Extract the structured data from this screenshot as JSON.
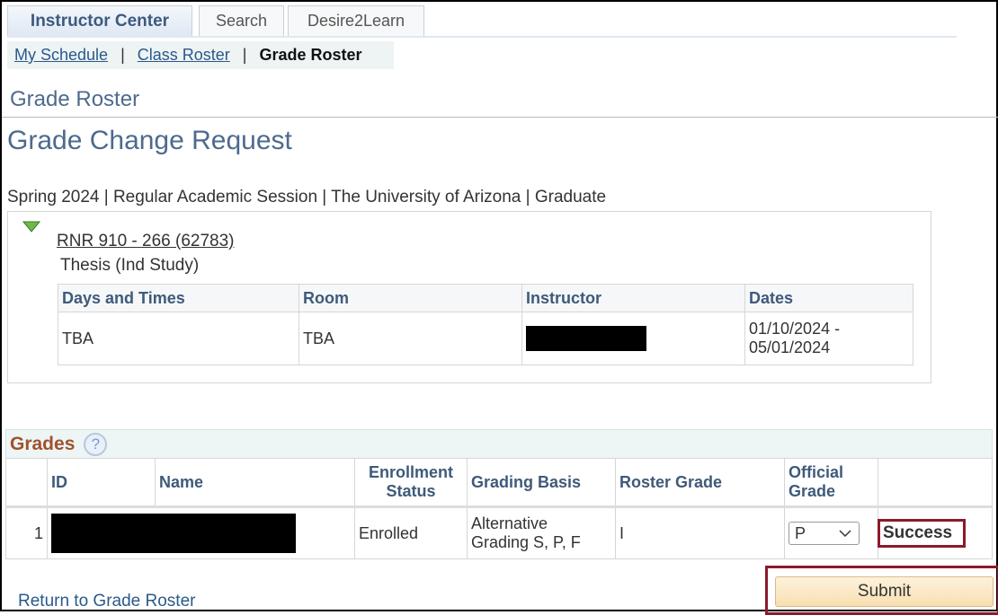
{
  "tabs": [
    {
      "label": "Instructor Center",
      "active": true
    },
    {
      "label": "Search"
    },
    {
      "label": "Desire2Learn"
    }
  ],
  "subnav": {
    "items": [
      "My Schedule",
      "Class Roster",
      "Grade Roster"
    ],
    "separator": "|"
  },
  "page_title": "Grade Roster",
  "heading": "Grade Change Request",
  "term_line": "Spring 2024 | Regular Academic Session | The University of Arizona | Graduate",
  "class": {
    "link": "RNR 910 - 266 (62783)",
    "description": "Thesis (Ind Study)",
    "headers": [
      "Days and Times",
      "Room",
      "Instructor",
      "Dates"
    ],
    "row": {
      "days": "TBA",
      "room": "TBA",
      "instructor": "[redacted]",
      "dates_start": "01/10/2024 -",
      "dates_end": "05/01/2024"
    }
  },
  "grades": {
    "title": "Grades",
    "help_icon": "question-circle-icon",
    "headers": [
      "",
      "ID",
      "Name",
      "Enrollment Status",
      "Grading Basis",
      "Roster Grade",
      "Official Grade",
      ""
    ],
    "rows": [
      {
        "num": "1",
        "id": "[redacted]",
        "name": "[redacted]",
        "status": "Enrolled",
        "basis_1": "Alternative",
        "basis_2": "Grading S, P, F",
        "roster_grade": "I",
        "official_grade": "P",
        "result": "Success"
      }
    ]
  },
  "submit_label": "Submit",
  "return_link": "Return to Grade Roster",
  "colors": {
    "accent_box": "#8b1a2b",
    "title_blue": "#4d6a8f",
    "grades_title": "#a0522d"
  }
}
